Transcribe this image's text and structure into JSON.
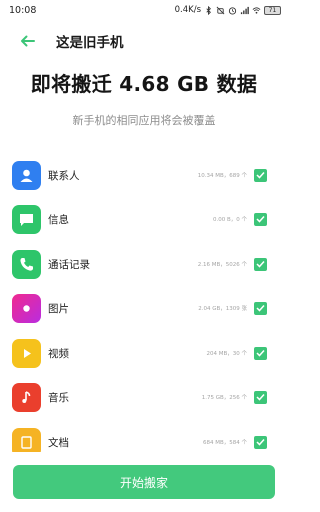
{
  "status_bar": {
    "time": "10:08",
    "speed": "0.4K/s",
    "battery": "71"
  },
  "header": {
    "title": "这是旧手机"
  },
  "headline": "即将搬迁 4.68 GB 数据",
  "subline": "新手机的相同应用将会被覆盖",
  "items": [
    {
      "label": "联系人",
      "size": "10.34 MB，689 个",
      "icon": "contacts-icon",
      "color": "#2f7ff0",
      "checked": true
    },
    {
      "label": "信息",
      "size": "0.00 B，0 个",
      "icon": "message-icon",
      "color": "#2ec56a",
      "checked": true
    },
    {
      "label": "通话记录",
      "size": "2.16 MB，5026 个",
      "icon": "phone-icon",
      "color": "#2ec56a",
      "checked": true
    },
    {
      "label": "图片",
      "size": "2.04 GB，1309 张",
      "icon": "gallery-icon",
      "color": "#e8409a",
      "checked": true
    },
    {
      "label": "视频",
      "size": "204 MB，30 个",
      "icon": "video-icon",
      "color": "#f5c21c",
      "checked": true
    },
    {
      "label": "音乐",
      "size": "1.75 GB，256 个",
      "icon": "music-icon",
      "color": "#ea3f2d",
      "checked": true
    },
    {
      "label": "文档",
      "size": "684 MB，584 个",
      "icon": "document-icon",
      "color": "#f5b324",
      "checked": true
    }
  ],
  "start_button": "开始搬家",
  "colors": {
    "accent": "#3cc578",
    "button": "#43c97d"
  }
}
